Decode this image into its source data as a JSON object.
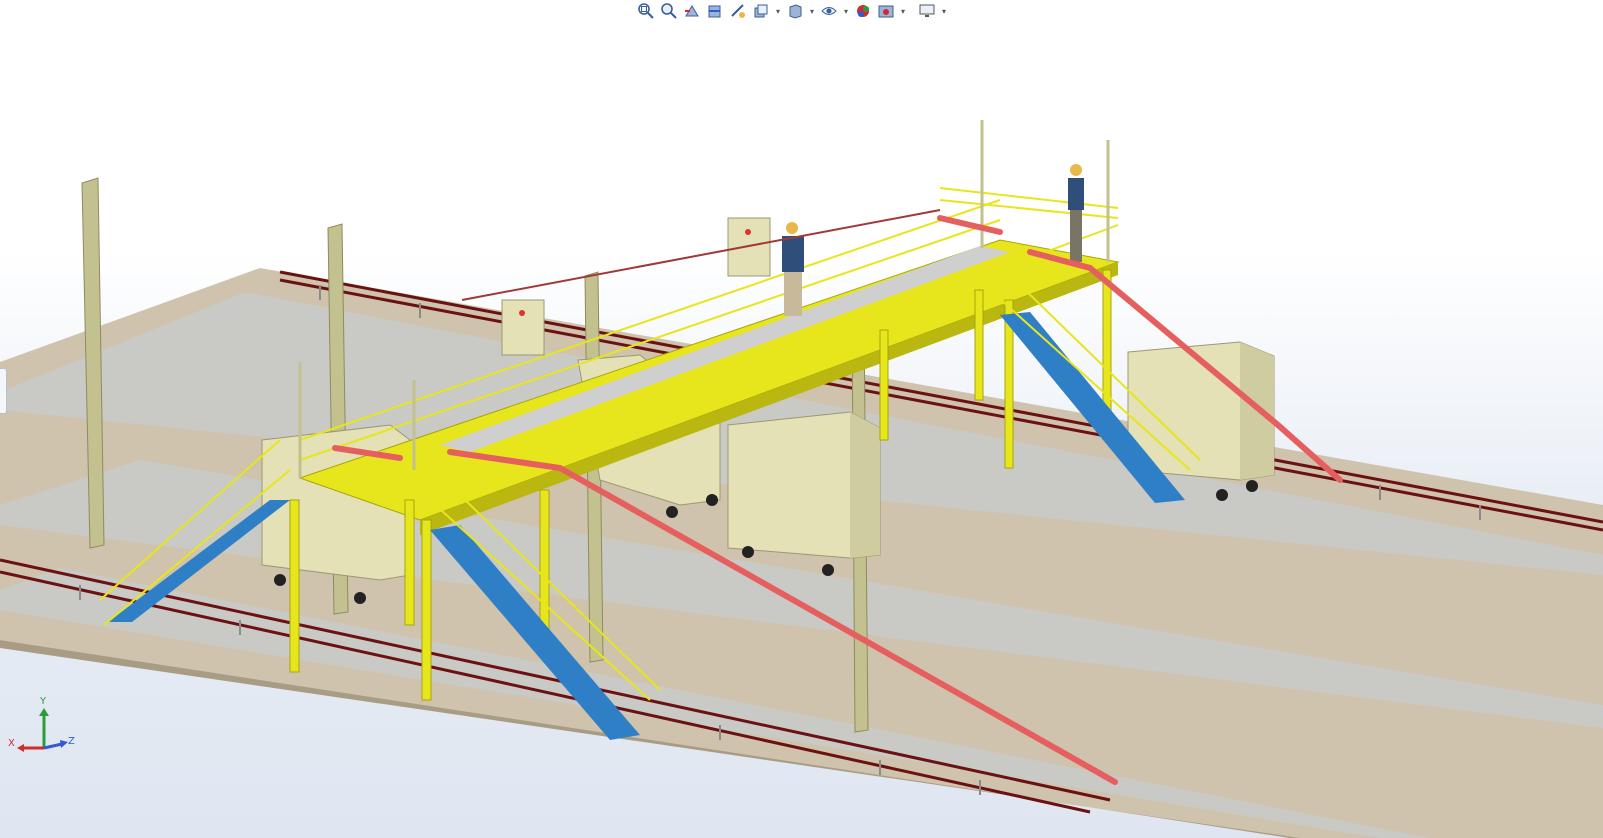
{
  "toolbar": {
    "items": [
      {
        "name": "zoom-to-fit-icon",
        "caret": false
      },
      {
        "name": "zoom-to-area-icon",
        "caret": false
      },
      {
        "name": "previous-view-icon",
        "caret": false
      },
      {
        "name": "section-view-icon",
        "caret": false
      },
      {
        "name": "dynamic-annotation-views-icon",
        "caret": false
      },
      {
        "name": "view-orientation-icon",
        "caret": true
      },
      {
        "name": "display-style-icon",
        "caret": true
      },
      {
        "name": "hide-show-items-icon",
        "caret": true
      },
      {
        "name": "edit-appearance-icon",
        "caret": false
      },
      {
        "name": "apply-scene-icon",
        "caret": true
      },
      {
        "name": "view-settings-icon",
        "caret": true
      }
    ],
    "caret_glyph": "▾"
  },
  "triad": {
    "x_label": "X",
    "y_label": "Y",
    "z_label": "Z",
    "x_color": "#d22b2b",
    "y_color": "#2a9d3a",
    "z_color": "#2f59d6"
  },
  "colors": {
    "ground": "#cfc3ad",
    "ground_dark": "#b8ab93",
    "track_bed": "#bdbdbd",
    "steel_yellow": "#e7e61c",
    "steel_yellow_dark": "#b9b710",
    "pole": "#c2c18f",
    "stair_tread": "#2f7fc7",
    "cable": "#e65f5f",
    "rail": "#7a0f0f",
    "cabinet": "#e3e1b5",
    "grey_pole": "#9ea29a"
  }
}
